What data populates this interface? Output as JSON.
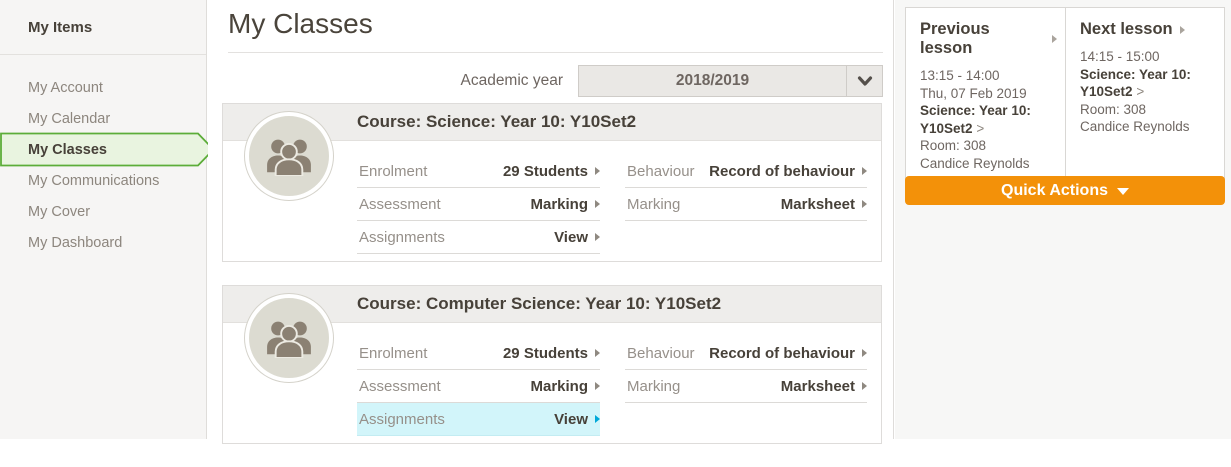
{
  "sidebar": {
    "header": "My Items",
    "items": [
      {
        "label": "My Account",
        "selected": false
      },
      {
        "label": "My Calendar",
        "selected": false
      },
      {
        "label": "My Classes",
        "selected": true
      },
      {
        "label": "My Communications",
        "selected": false
      },
      {
        "label": "My Cover",
        "selected": false
      },
      {
        "label": "My Dashboard",
        "selected": false
      }
    ]
  },
  "main": {
    "title": "My Classes",
    "academic_year_label": "Academic year",
    "academic_year_value": "2018/2019",
    "cards": [
      {
        "title": "Course: Science: Year 10: Y10Set2",
        "left_rows": [
          {
            "label": "Enrolment",
            "value": "29 Students"
          },
          {
            "label": "Assessment",
            "value": "Marking"
          },
          {
            "label": "Assignments",
            "value": "View"
          }
        ],
        "right_rows": [
          {
            "label": "Behaviour",
            "value": "Record of behaviour"
          },
          {
            "label": "Marking",
            "value": "Marksheet"
          }
        ]
      },
      {
        "title": "Course: Computer Science: Year 10: Y10Set2",
        "left_rows": [
          {
            "label": "Enrolment",
            "value": "29 Students"
          },
          {
            "label": "Assessment",
            "value": "Marking"
          },
          {
            "label": "Assignments",
            "value": "View",
            "highlighted": true
          }
        ],
        "right_rows": [
          {
            "label": "Behaviour",
            "value": "Record of behaviour"
          },
          {
            "label": "Marking",
            "value": "Marksheet"
          }
        ]
      }
    ]
  },
  "lessons": {
    "previous": {
      "title": "Previous lesson",
      "time": "13:15 - 14:00",
      "date": "Thu, 07 Feb 2019",
      "course_line1": "Science: Year 10:",
      "course_line2": "Y10Set2",
      "link_chevron": ">",
      "room": "Room: 308",
      "teacher": "Candice Reynolds"
    },
    "next": {
      "title": "Next lesson",
      "time": "14:15 - 15:00",
      "course_line1": "Science: Year 10:",
      "course_line2": "Y10Set2",
      "link_chevron": ">",
      "room": "Room: 308",
      "teacher": "Candice Reynolds"
    }
  },
  "quick_actions_label": "Quick Actions",
  "icons": {
    "avatar": "users-group-icon",
    "year_select": "chevron-down-icon",
    "row_link": "chevron-right-icon",
    "lesson_header": "chevron-right-icon",
    "quick_actions": "caret-down-icon"
  },
  "colors": {
    "accent_orange": "#f39109",
    "selected_green_border": "#5cad39",
    "selected_green_bg": "#e9f4e0",
    "highlight_cyan_bg": "#d2f5fa",
    "highlight_link": "#00a8d8",
    "sidebar_bg": "#f6f5f4",
    "card_header_bg": "#eeedeb"
  }
}
